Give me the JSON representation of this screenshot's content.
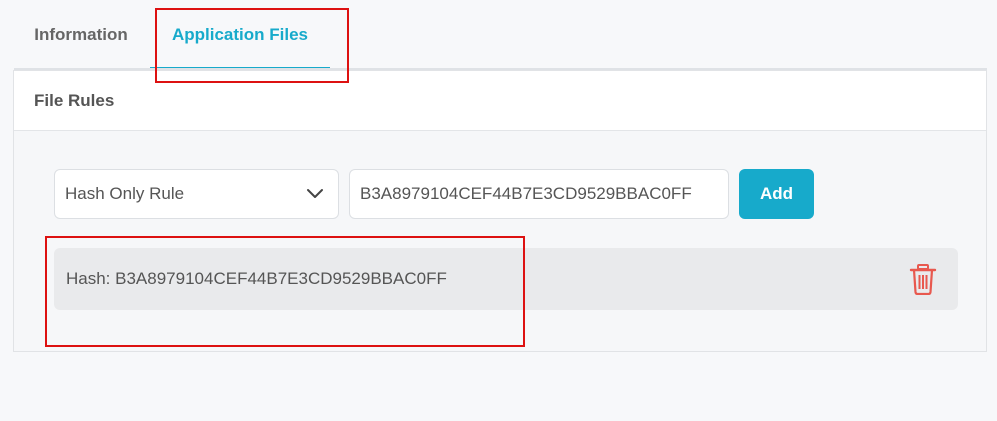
{
  "tabs": [
    {
      "label": "Information",
      "active": false
    },
    {
      "label": "Application Files",
      "active": true
    }
  ],
  "panel": {
    "title": "File Rules",
    "rule_type": {
      "selected": "Hash Only Rule"
    },
    "hash_input": {
      "value": "B3A8979104CEF44B7E3CD9529BBAC0FF"
    },
    "add_label": "Add",
    "rules": [
      {
        "text": "Hash: B3A8979104CEF44B7E3CD9529BBAC0FF",
        "icon": "trash-icon"
      }
    ]
  },
  "colors": {
    "accent": "#17aacb",
    "annotation": "#dd1111",
    "delete": "#e8584e"
  }
}
